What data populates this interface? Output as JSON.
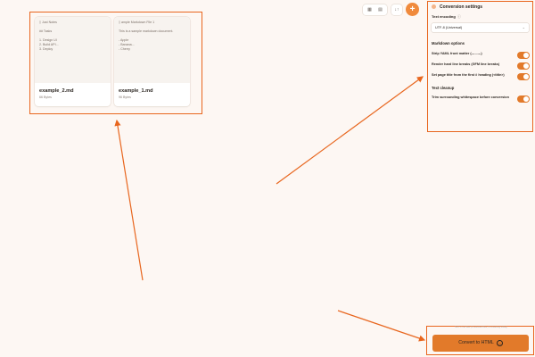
{
  "files": [
    {
      "preview_title": "Just Notes",
      "preview_lines": [
        "## Tasks",
        "",
        "1. Design UI",
        "2. Build API...",
        "3. Deploy"
      ],
      "name": "example_2.md",
      "size": "66 Bytes"
    },
    {
      "preview_title": "ample Markdown File 1",
      "preview_lines": [
        "This is a sample markdown document.",
        "",
        "- Apple",
        "- Banana...",
        "- Cherry"
      ],
      "name": "example_1.md",
      "size": "96 Bytes"
    }
  ],
  "toolbar": {
    "view_grid_icon": "grid-icon",
    "view_list_icon": "list-icon",
    "sort_label": "↓↑",
    "add_label": "+"
  },
  "settings": {
    "title": "Conversion settings",
    "text_encoding_label": "Text encoding",
    "help_glyph": "ⓘ",
    "encoding_value": "UTF-8 (Universal)",
    "markdown_options_label": "Markdown options",
    "options": [
      {
        "label": "Strip YAML front matter (---...---)",
        "on": true
      },
      {
        "label": "Render hard line breaks (GFM line breaks)",
        "on": true
      },
      {
        "label": "Set page title from the first # heading (<title>)",
        "on": true
      }
    ],
    "text_cleanup_label": "Text cleanup",
    "cleanup_options": [
      {
        "label": "Trim surrounding whitespace before conversion",
        "on": true
      }
    ]
  },
  "status_text": "Sort: 2 md files (2 selected files, 0 remaining today)",
  "convert_label": "Convert to HTML",
  "colors": {
    "accent": "#e27a2a",
    "highlight": "#e8661e",
    "background": "#fdf7f3"
  }
}
